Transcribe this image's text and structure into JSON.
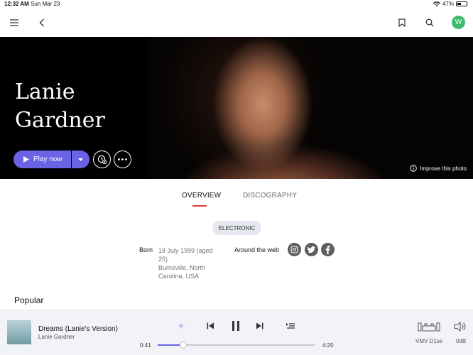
{
  "status_bar": {
    "time": "12:32 AM",
    "date": "Sun Mar 23",
    "battery": "47%",
    "battery_level": 0.47
  },
  "header": {
    "avatar_letter": "W"
  },
  "artist": {
    "name": "Lanie Gardner",
    "play_label": "Play now",
    "improve_photo_label": "Improve this photo"
  },
  "tabs": [
    {
      "label": "OVERVIEW",
      "active": true
    },
    {
      "label": "DISCOGRAPHY",
      "active": false
    }
  ],
  "genre": "ELECTRONIC",
  "born": {
    "label": "Born",
    "date_line1": "18 July 1999 (aged",
    "date_line2": "25)",
    "place_line1": "Burnsville, North",
    "place_line2": "Carolina, USA"
  },
  "around_the_web": {
    "label": "Around the web"
  },
  "sections": {
    "popular": "Popular"
  },
  "player": {
    "track_title": "Dreams (Lanie's Version)",
    "track_artist": "Lanie Gardner",
    "elapsed": "0:41",
    "duration": "4:20",
    "progress": 0.16,
    "device": "VMV D1se",
    "volume": "0dB"
  },
  "colors": {
    "accent": "#6b63e6",
    "tab_underline": "#e03a3a",
    "avatar": "#3dbb6e"
  }
}
